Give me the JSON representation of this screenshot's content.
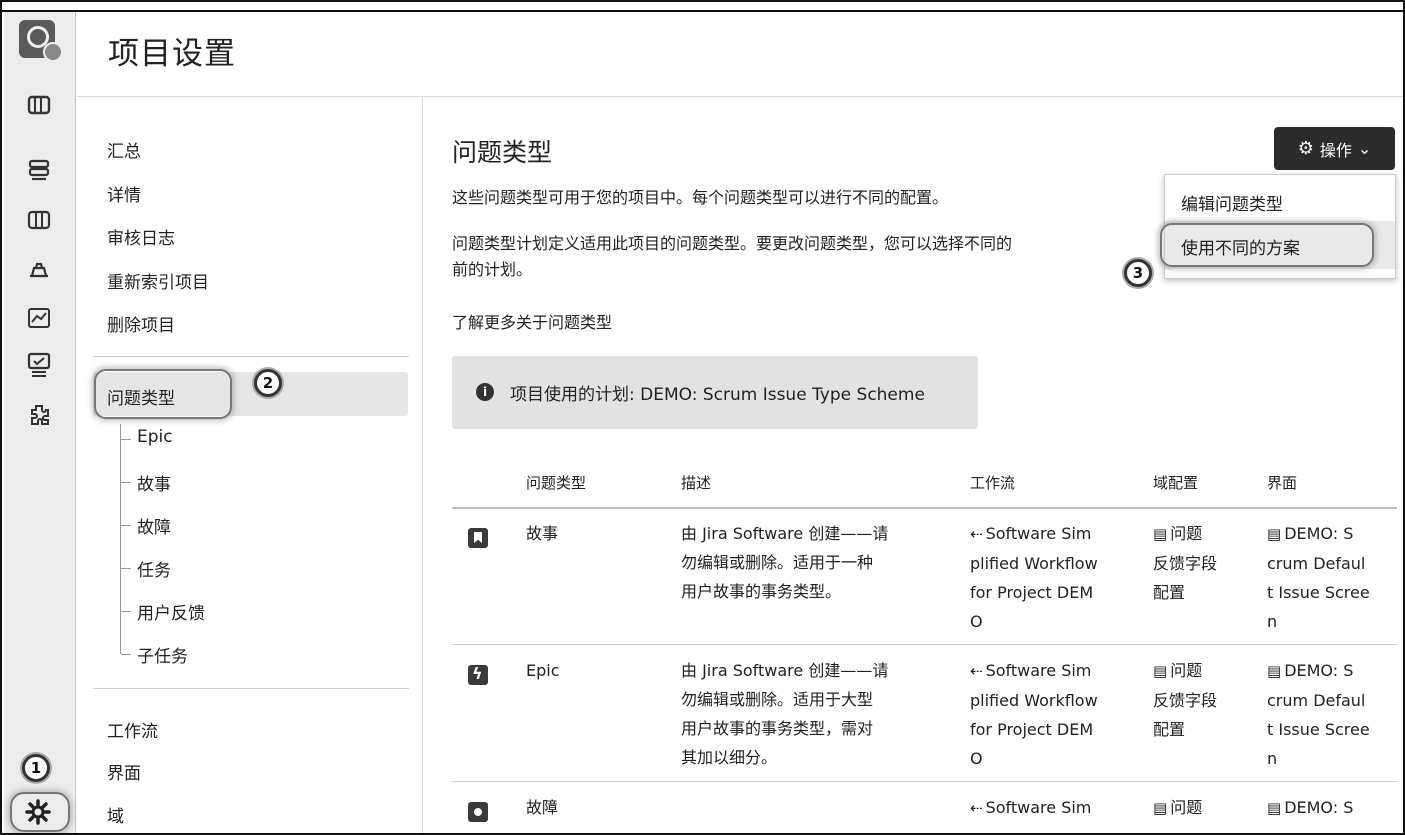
{
  "page": {
    "title": "项目设置"
  },
  "nav": {
    "group1": [
      "汇总",
      "详情",
      "审核日志",
      "重新索引项目",
      "删除项目"
    ],
    "issue_types": "问题类型",
    "sub_items": [
      "Epic",
      "故事",
      "故障",
      "任务",
      "用户反馈",
      "子任务"
    ],
    "group2": [
      "工作流",
      "界面",
      "域"
    ]
  },
  "main": {
    "heading": "问题类型",
    "desc1": "这些问题类型可用于您的项目中。每个问题类型可以进行不同的配置。",
    "desc2a": "问题类型计划定义适用此项目的问题类型。要更改问题类型，您可以选择不同的",
    "desc2b": "前的计划。",
    "learn_more": "了解更多关于问题类型",
    "scheme_label": "项目使用的计划: DEMO: Scrum Issue Type Scheme",
    "info_icon": "info-icon"
  },
  "actions": {
    "button_label": "操作",
    "menu": [
      "编辑问题类型",
      "使用不同的方案"
    ]
  },
  "callouts": [
    "1",
    "2",
    "3"
  ],
  "table": {
    "headers": [
      "问题类型",
      "描述",
      "工作流",
      "域配置",
      "界面"
    ],
    "rows": [
      {
        "icon": "story-icon",
        "name": "故事",
        "description": [
          "由 Jira Software 创建——请",
          "勿编辑或删除。适用于一种",
          "用户故事的事务类型。"
        ],
        "workflow": [
          "Software Sim",
          "plified Workflow",
          "for Project DEM",
          "O"
        ],
        "field_config": [
          "问题",
          "反馈字段",
          "配置"
        ],
        "screen": [
          "DEMO: S",
          "crum Defaul",
          "t Issue Scree",
          "n"
        ]
      },
      {
        "icon": "epic-icon",
        "name": "Epic",
        "description": [
          "由 Jira Software 创建——请",
          "勿编辑或删除。适用于大型",
          "用户故事的事务类型，需对",
          "其加以细分。"
        ],
        "workflow": [
          "Software Sim",
          "plified Workflow",
          "for Project DEM",
          "O"
        ],
        "field_config": [
          "问题",
          "反馈字段",
          "配置"
        ],
        "screen": [
          "DEMO: S",
          "crum Defaul",
          "t Issue Scree",
          "n"
        ]
      },
      {
        "icon": "bug-icon",
        "name": "故障",
        "description": [],
        "workflow": [
          "Software Sim"
        ],
        "field_config": [
          "问题"
        ],
        "screen": [
          "DEMO: S"
        ]
      }
    ]
  },
  "colors": {
    "button_bg": "#2b2b2b",
    "rail_bg": "#ececec",
    "selected_bg": "#e6e6e6"
  }
}
